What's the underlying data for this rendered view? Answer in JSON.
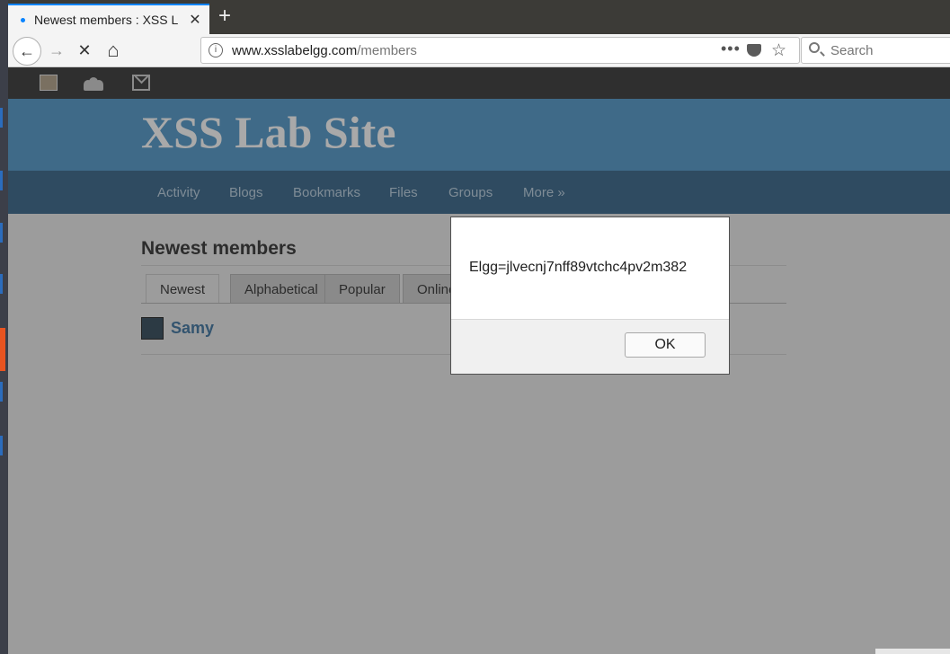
{
  "browser": {
    "tab_title": "Newest members : XSS L",
    "tab_close": "✕",
    "new_tab": "+",
    "url_domain": "www.xsslabelgg.com",
    "url_path": "/members",
    "search_placeholder": "Search",
    "url_more": "•••",
    "star_glyph": "☆",
    "info_glyph": "i"
  },
  "nav_icons": {
    "back": "←",
    "forward": "→",
    "stop": "✕",
    "home": "⌂"
  },
  "site": {
    "name": "XSS Lab Site",
    "menu": [
      "Activity",
      "Blogs",
      "Bookmarks",
      "Files",
      "Groups",
      "More »"
    ]
  },
  "page": {
    "title": "Newest members",
    "tabs": [
      "Newest",
      "Alphabetical",
      "Popular",
      "Online"
    ],
    "selected_tab": "Newest",
    "members": [
      {
        "name": "Samy"
      }
    ]
  },
  "dialog": {
    "message": "Elgg=jlvecnj7nff89vtchc4pv2m382",
    "ok_label": "OK"
  },
  "colors": {
    "accent": "#0a84ff",
    "launcher_active": "#e95420",
    "header_bg": "#3f6a88"
  }
}
